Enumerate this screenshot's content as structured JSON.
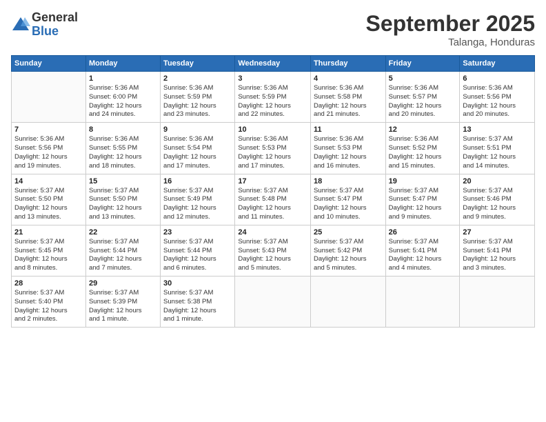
{
  "logo": {
    "general": "General",
    "blue": "Blue"
  },
  "header": {
    "title": "September 2025",
    "location": "Talanga, Honduras"
  },
  "days_of_week": [
    "Sunday",
    "Monday",
    "Tuesday",
    "Wednesday",
    "Thursday",
    "Friday",
    "Saturday"
  ],
  "weeks": [
    [
      {
        "day": "",
        "info": ""
      },
      {
        "day": "1",
        "info": "Sunrise: 5:36 AM\nSunset: 6:00 PM\nDaylight: 12 hours\nand 24 minutes."
      },
      {
        "day": "2",
        "info": "Sunrise: 5:36 AM\nSunset: 5:59 PM\nDaylight: 12 hours\nand 23 minutes."
      },
      {
        "day": "3",
        "info": "Sunrise: 5:36 AM\nSunset: 5:59 PM\nDaylight: 12 hours\nand 22 minutes."
      },
      {
        "day": "4",
        "info": "Sunrise: 5:36 AM\nSunset: 5:58 PM\nDaylight: 12 hours\nand 21 minutes."
      },
      {
        "day": "5",
        "info": "Sunrise: 5:36 AM\nSunset: 5:57 PM\nDaylight: 12 hours\nand 20 minutes."
      },
      {
        "day": "6",
        "info": "Sunrise: 5:36 AM\nSunset: 5:56 PM\nDaylight: 12 hours\nand 20 minutes."
      }
    ],
    [
      {
        "day": "7",
        "info": "Sunrise: 5:36 AM\nSunset: 5:56 PM\nDaylight: 12 hours\nand 19 minutes."
      },
      {
        "day": "8",
        "info": "Sunrise: 5:36 AM\nSunset: 5:55 PM\nDaylight: 12 hours\nand 18 minutes."
      },
      {
        "day": "9",
        "info": "Sunrise: 5:36 AM\nSunset: 5:54 PM\nDaylight: 12 hours\nand 17 minutes."
      },
      {
        "day": "10",
        "info": "Sunrise: 5:36 AM\nSunset: 5:53 PM\nDaylight: 12 hours\nand 17 minutes."
      },
      {
        "day": "11",
        "info": "Sunrise: 5:36 AM\nSunset: 5:53 PM\nDaylight: 12 hours\nand 16 minutes."
      },
      {
        "day": "12",
        "info": "Sunrise: 5:36 AM\nSunset: 5:52 PM\nDaylight: 12 hours\nand 15 minutes."
      },
      {
        "day": "13",
        "info": "Sunrise: 5:37 AM\nSunset: 5:51 PM\nDaylight: 12 hours\nand 14 minutes."
      }
    ],
    [
      {
        "day": "14",
        "info": "Sunrise: 5:37 AM\nSunset: 5:50 PM\nDaylight: 12 hours\nand 13 minutes."
      },
      {
        "day": "15",
        "info": "Sunrise: 5:37 AM\nSunset: 5:50 PM\nDaylight: 12 hours\nand 13 minutes."
      },
      {
        "day": "16",
        "info": "Sunrise: 5:37 AM\nSunset: 5:49 PM\nDaylight: 12 hours\nand 12 minutes."
      },
      {
        "day": "17",
        "info": "Sunrise: 5:37 AM\nSunset: 5:48 PM\nDaylight: 12 hours\nand 11 minutes."
      },
      {
        "day": "18",
        "info": "Sunrise: 5:37 AM\nSunset: 5:47 PM\nDaylight: 12 hours\nand 10 minutes."
      },
      {
        "day": "19",
        "info": "Sunrise: 5:37 AM\nSunset: 5:47 PM\nDaylight: 12 hours\nand 9 minutes."
      },
      {
        "day": "20",
        "info": "Sunrise: 5:37 AM\nSunset: 5:46 PM\nDaylight: 12 hours\nand 9 minutes."
      }
    ],
    [
      {
        "day": "21",
        "info": "Sunrise: 5:37 AM\nSunset: 5:45 PM\nDaylight: 12 hours\nand 8 minutes."
      },
      {
        "day": "22",
        "info": "Sunrise: 5:37 AM\nSunset: 5:44 PM\nDaylight: 12 hours\nand 7 minutes."
      },
      {
        "day": "23",
        "info": "Sunrise: 5:37 AM\nSunset: 5:44 PM\nDaylight: 12 hours\nand 6 minutes."
      },
      {
        "day": "24",
        "info": "Sunrise: 5:37 AM\nSunset: 5:43 PM\nDaylight: 12 hours\nand 5 minutes."
      },
      {
        "day": "25",
        "info": "Sunrise: 5:37 AM\nSunset: 5:42 PM\nDaylight: 12 hours\nand 5 minutes."
      },
      {
        "day": "26",
        "info": "Sunrise: 5:37 AM\nSunset: 5:41 PM\nDaylight: 12 hours\nand 4 minutes."
      },
      {
        "day": "27",
        "info": "Sunrise: 5:37 AM\nSunset: 5:41 PM\nDaylight: 12 hours\nand 3 minutes."
      }
    ],
    [
      {
        "day": "28",
        "info": "Sunrise: 5:37 AM\nSunset: 5:40 PM\nDaylight: 12 hours\nand 2 minutes."
      },
      {
        "day": "29",
        "info": "Sunrise: 5:37 AM\nSunset: 5:39 PM\nDaylight: 12 hours\nand 1 minute."
      },
      {
        "day": "30",
        "info": "Sunrise: 5:37 AM\nSunset: 5:38 PM\nDaylight: 12 hours\nand 1 minute."
      },
      {
        "day": "",
        "info": ""
      },
      {
        "day": "",
        "info": ""
      },
      {
        "day": "",
        "info": ""
      },
      {
        "day": "",
        "info": ""
      }
    ]
  ]
}
